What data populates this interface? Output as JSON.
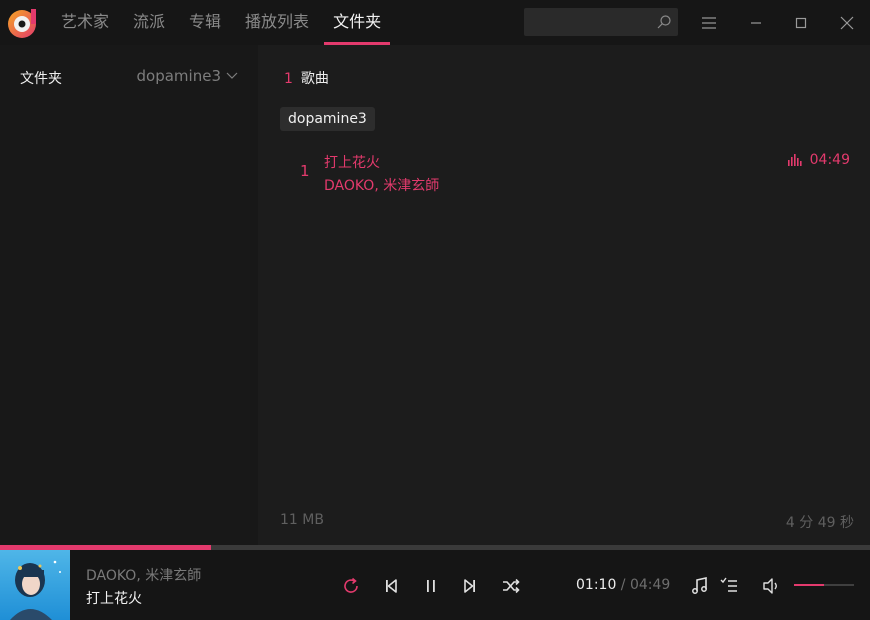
{
  "nav": {
    "tabs": [
      {
        "label": "艺术家"
      },
      {
        "label": "流派"
      },
      {
        "label": "专辑"
      },
      {
        "label": "播放列表"
      },
      {
        "label": "文件夹"
      }
    ],
    "active_tab": "文件夹"
  },
  "search": {
    "placeholder": ""
  },
  "sidebar": {
    "title": "文件夹",
    "folder_dropdown": "dopamine3"
  },
  "main": {
    "song_count": "1",
    "song_count_label": "歌曲",
    "folder_tag": "dopamine3",
    "songs": [
      {
        "index": "1",
        "title": "打上花火",
        "artist": "DAOKO, 米津玄師",
        "duration": "04:49",
        "playing": true
      }
    ],
    "footer_size": "11 MB",
    "footer_duration": "4 分 49 秒"
  },
  "player": {
    "artist": "DAOKO, 米津玄師",
    "title": "打上花火",
    "current_time": "01:10",
    "separator": " / ",
    "total_time": "04:49",
    "progress_fraction": 0.242,
    "volume_fraction": 0.5
  },
  "colors": {
    "accent": "#e33a6d",
    "background": "#1c1c1c",
    "sidebar": "#181818",
    "player": "#151515"
  }
}
